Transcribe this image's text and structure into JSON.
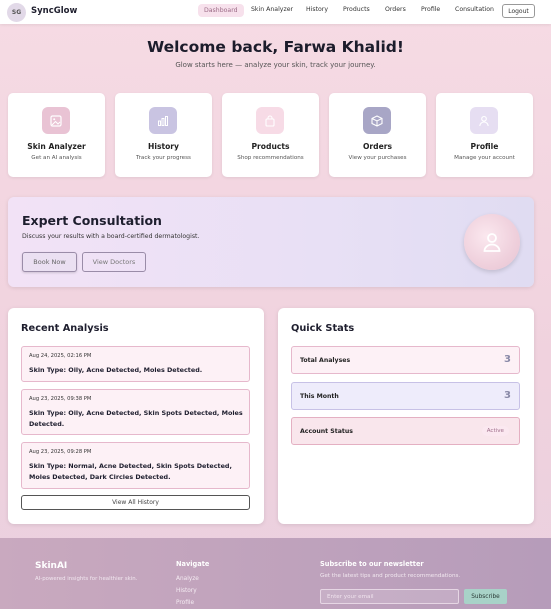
{
  "nav": {
    "logo_badge": "SG",
    "app_name": "SyncGlow",
    "items": [
      {
        "label": "Dashboard",
        "active": true
      },
      {
        "label": "Skin Analyzer"
      },
      {
        "label": "History"
      },
      {
        "label": "Products"
      },
      {
        "label": "Orders"
      },
      {
        "label": "Profile"
      },
      {
        "label": "Consultation"
      }
    ],
    "logout_label": "Logout"
  },
  "hero": {
    "title": "Welcome back, Farwa Khalid!",
    "subtitle": "Glow starts here — analyze your skin, track your journey."
  },
  "cards": [
    {
      "title": "Skin Analyzer",
      "subtitle": "Get an AI analysis",
      "icon": "image-icon",
      "color": "#e9c3d4"
    },
    {
      "title": "History",
      "subtitle": "Track your progress",
      "icon": "bar-chart-icon",
      "color": "#c9c4e2"
    },
    {
      "title": "Products",
      "subtitle": "Shop recommendations",
      "icon": "shopping-bag-icon",
      "color": "#f7dbe6"
    },
    {
      "title": "Orders",
      "subtitle": "View your purchases",
      "icon": "box-icon",
      "color": "#a8a6c6"
    },
    {
      "title": "Profile",
      "subtitle": "Manage your account",
      "icon": "user-icon",
      "color": "#e6def2"
    }
  ],
  "consultation": {
    "title": "Expert Consultation",
    "description": "Discuss your results with a board-certified dermatologist.",
    "book_label": "Book Now",
    "doctors_label": "View Doctors"
  },
  "recent": {
    "title": "Recent Analysis",
    "items": [
      {
        "date": "Aug 24, 2025, 02:16 PM",
        "summary": "Skin Type: Oily, Acne Detected, Moles Detected."
      },
      {
        "date": "Aug 23, 2025, 09:38 PM",
        "summary": "Skin Type: Oily, Acne Detected, Skin Spots Detected, Moles Detected."
      },
      {
        "date": "Aug 23, 2025, 09:28 PM",
        "summary": "Skin Type: Normal, Acne Detected, Skin Spots Detected, Moles Detected, Dark Circles Detected."
      }
    ],
    "view_all_label": "View All History"
  },
  "stats": {
    "title": "Quick Stats",
    "items": [
      {
        "label": "Total Analyses",
        "value": "3",
        "bg": "#fdf1f6",
        "border": "#e6b8cc"
      },
      {
        "label": "This Month",
        "value": "3",
        "bg": "#eeecfb",
        "border": "#c7c1e6"
      },
      {
        "label": "Account Status",
        "value": "Active",
        "bg": "#f9e6ec",
        "border": "#e4b0c2"
      }
    ]
  },
  "footer": {
    "brand": "SkinAI",
    "tagline": "AI-powered insights for healthier skin.",
    "navigate_title": "Navigate",
    "links": [
      "Analyze",
      "History",
      "Profile"
    ],
    "newsletter_title": "Subscribe to our newsletter",
    "newsletter_desc": "Get the latest tips and product recommendations.",
    "email_placeholder": "Enter your email",
    "subscribe_label": "Subscribe"
  }
}
